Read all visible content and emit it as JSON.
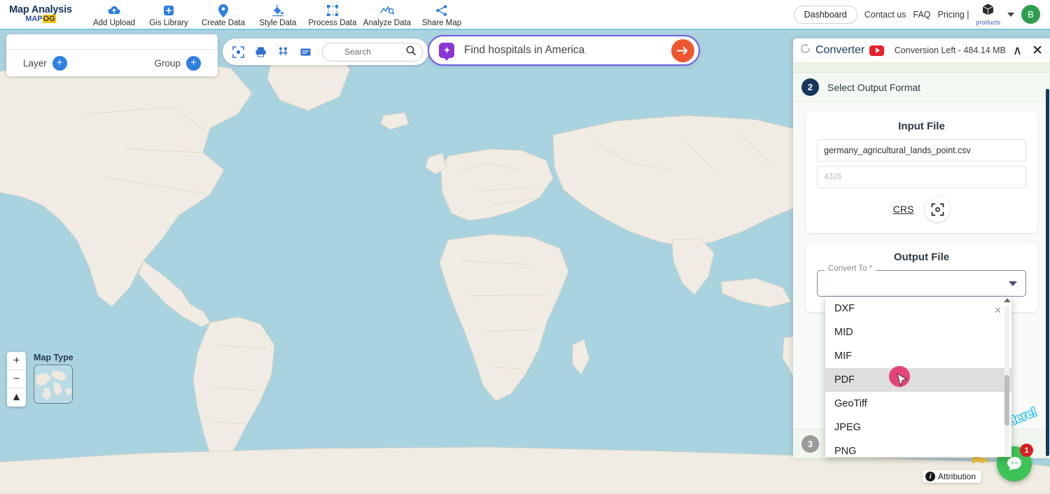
{
  "brand": {
    "title": "Map Analysis",
    "sub_a": "MAP",
    "sub_b": "OG"
  },
  "nav": {
    "items": [
      {
        "label": "Add Upload",
        "icon": "cloud-upload-icon"
      },
      {
        "label": "Gis Library",
        "icon": "library-plus-icon"
      },
      {
        "label": "Create Data",
        "icon": "map-pin-icon"
      },
      {
        "label": "Style Data",
        "icon": "paint-bucket-icon"
      },
      {
        "label": "Process Data",
        "icon": "process-nodes-icon"
      },
      {
        "label": "Analyze Data",
        "icon": "analyze-chart-icon"
      },
      {
        "label": "Share Map",
        "icon": "share-icon"
      }
    ],
    "dashboard": "Dashboard",
    "contact": "Contact us",
    "faq": "FAQ",
    "pricing": "Pricing |",
    "products": "products",
    "avatar_initial": "B"
  },
  "layer_panel": {
    "layer_label": "Layer",
    "group_label": "Group",
    "add_symbol": "+"
  },
  "map_tools": {
    "icons": [
      "focus-frame-icon",
      "print-icon",
      "measure-icon",
      "legend-icon"
    ],
    "search_placeholder": "Search"
  },
  "ai_search": {
    "value": "Find hospitals in America",
    "icon": "ai-sparkle-icon",
    "go_icon": "arrow-right-icon"
  },
  "map_controls": {
    "zoom_in": "+",
    "zoom_out": "−",
    "compass": "▲",
    "map_type_label": "Map Type"
  },
  "attribution": {
    "label": "Attribution",
    "icon": "info-icon"
  },
  "converter": {
    "title": "Converter",
    "video_icon": "youtube-play-icon",
    "conversion_left": "Conversion Left - 484.14 MB",
    "collapse_icon": "∧",
    "close_icon": "✕",
    "step2_number": "2",
    "step2_label": "Select Output Format",
    "step3_number": "3",
    "input_card": {
      "title": "Input File",
      "filename": "germany_agricultural_lands_point.csv",
      "crs_value": "4326",
      "crs_label": "CRS",
      "crs_icon": "crosshair-icon"
    },
    "output_card": {
      "title": "Output File",
      "select_legend": "Convert To *",
      "select_value": "",
      "options": [
        "DXF",
        "MID",
        "MIF",
        "PDF",
        "GeoTiff",
        "JPEG",
        "PNG"
      ],
      "highlighted_option": "PDF"
    }
  },
  "chat": {
    "tooltip": "We Are Here!",
    "badge_count": "1",
    "icon": "chat-bubble-icon"
  },
  "colors": {
    "ocean": "#aad3e0",
    "land": "#f0ece3",
    "accent_purple": "#6c5ce7",
    "accent_orange": "#f0562d",
    "nav_blue": "#2f7fe0",
    "step_navy": "#17365d",
    "chat_green": "#3ec356",
    "badge_red": "#d61f26"
  }
}
